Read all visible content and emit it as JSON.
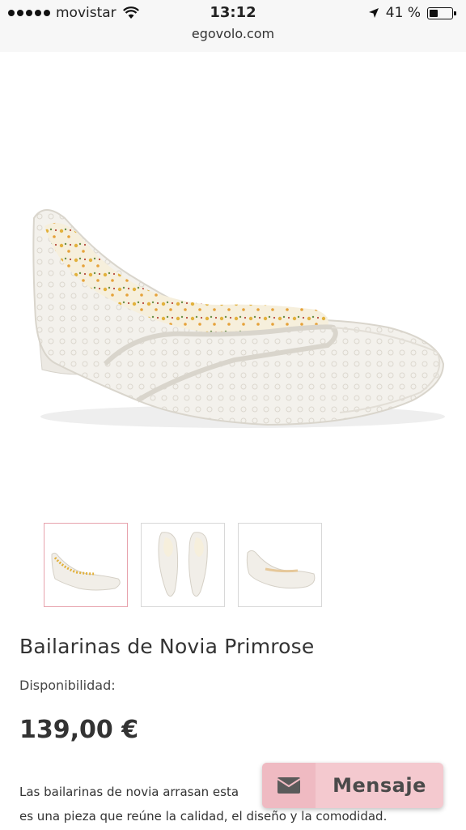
{
  "status_bar": {
    "carrier": "movistar",
    "time": "13:12",
    "battery_percent": "41 %",
    "battery_level": 0.41
  },
  "browser": {
    "address": "egovolo.com"
  },
  "product": {
    "title": "Bailarinas de Novia Primrose",
    "availability_label": "Disponibilidad:",
    "price": "139,00 €",
    "description_line1": "Las bailarinas de novia arrasan esta",
    "description_line1_end": ",",
    "description_line2": "es una pieza que reúne la calidad, el diseño y la comodidad."
  },
  "thumbnails": [
    {
      "name": "side-view",
      "active": true
    },
    {
      "name": "top-view",
      "active": false
    },
    {
      "name": "back-view",
      "active": false
    }
  ],
  "message_button": {
    "label": "Mensaje",
    "icon": "envelope-icon"
  },
  "colors": {
    "accent_pink": "#f4c9cf",
    "thumb_active_border": "#e7a3ad"
  }
}
